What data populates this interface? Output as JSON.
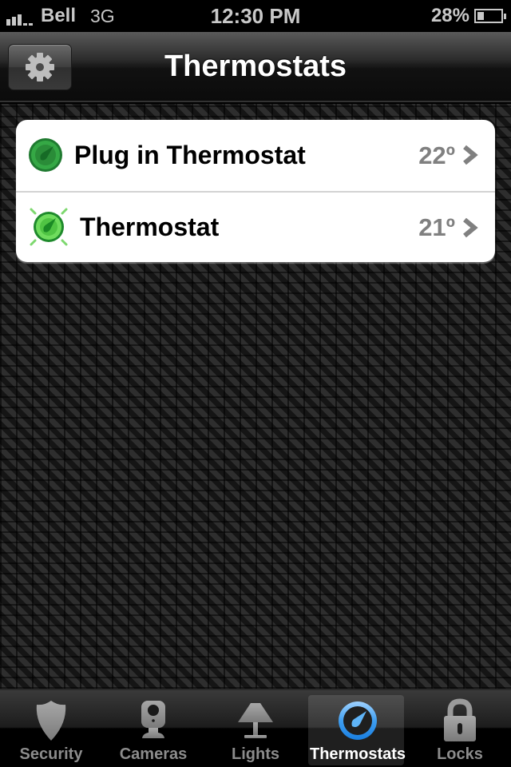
{
  "status_bar": {
    "signal_bars_filled": 3,
    "signal_bars_total": 5,
    "carrier": "Bell",
    "network": "3G",
    "time": "12:30 PM",
    "battery_percent_label": "28%",
    "battery_level": 0.28
  },
  "nav": {
    "title": "Thermostats",
    "settings_icon": "gear-icon"
  },
  "thermostats": [
    {
      "name": "Plug in Thermostat",
      "temperature": "22º",
      "icon": "thermostat-icon",
      "state": "idle"
    },
    {
      "name": "Thermostat",
      "temperature": "21º",
      "icon": "thermostat-active-icon",
      "state": "active"
    }
  ],
  "tab_bar": {
    "tabs": [
      {
        "label": "Security",
        "icon": "shield-icon",
        "active": false
      },
      {
        "label": "Cameras",
        "icon": "camera-icon",
        "active": false
      },
      {
        "label": "Lights",
        "icon": "lamp-icon",
        "active": false
      },
      {
        "label": "Thermostats",
        "icon": "gauge-icon",
        "active": true
      },
      {
        "label": "Locks",
        "icon": "lock-icon",
        "active": false
      }
    ]
  },
  "colors": {
    "accent_blue": "#3a9be8",
    "thermostat_green": "#2e9e3e",
    "thermostat_active_green": "#5fd55a",
    "value_gray": "#808080"
  }
}
